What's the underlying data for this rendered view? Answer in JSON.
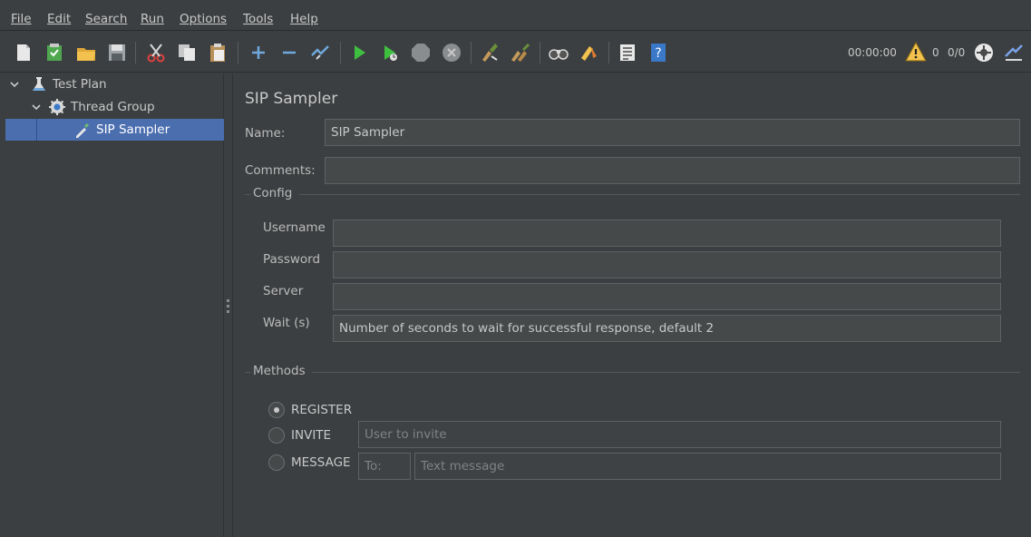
{
  "menu": [
    "File",
    "Edit",
    "Search",
    "Run",
    "Options",
    "Tools",
    "Help"
  ],
  "toolbar": {
    "timer": "00:00:00",
    "warning_count": "0",
    "thread_count": "0/0",
    "icons": [
      "new-icon",
      "templates-icon",
      "open-icon",
      "save-icon",
      "cut-icon",
      "copy-icon",
      "paste-icon",
      "expand-icon",
      "collapse-icon",
      "toggle-icon",
      "start-icon",
      "start-no-timers-icon",
      "stop-icon",
      "shutdown-icon",
      "clear-icon",
      "clear-all-icon",
      "search-icon",
      "reset-search-icon",
      "function-helper-icon",
      "help-icon",
      "warning-icon",
      "remote-icon",
      "log-icon"
    ]
  },
  "tree": {
    "items": [
      {
        "label": "Test Plan"
      },
      {
        "label": "Thread Group"
      },
      {
        "label": "SIP Sampler"
      }
    ]
  },
  "main": {
    "title": "SIP Sampler",
    "name_label": "Name:",
    "name_value": "SIP Sampler",
    "comments_label": "Comments:",
    "comments_value": "",
    "config": {
      "legend": "Config",
      "username_label": "Username",
      "username_value": "",
      "password_label": "Password",
      "password_value": "",
      "server_label": "Server",
      "server_value": "",
      "wait_label": "Wait (s)",
      "wait_placeholder": "Number of seconds to wait for successful response, default 2"
    },
    "methods": {
      "legend": "Methods",
      "register_label": "REGISTER",
      "invite_label": "INVITE",
      "invite_placeholder": "User to invite",
      "message_label": "MESSAGE",
      "to_placeholder": "To:",
      "text_placeholder": "Text message",
      "selected": "REGISTER"
    }
  },
  "colors": {
    "background": "#3c3f41",
    "selection": "#4b6eaf",
    "field": "#45494a",
    "run_green": "#3fbf3f"
  }
}
